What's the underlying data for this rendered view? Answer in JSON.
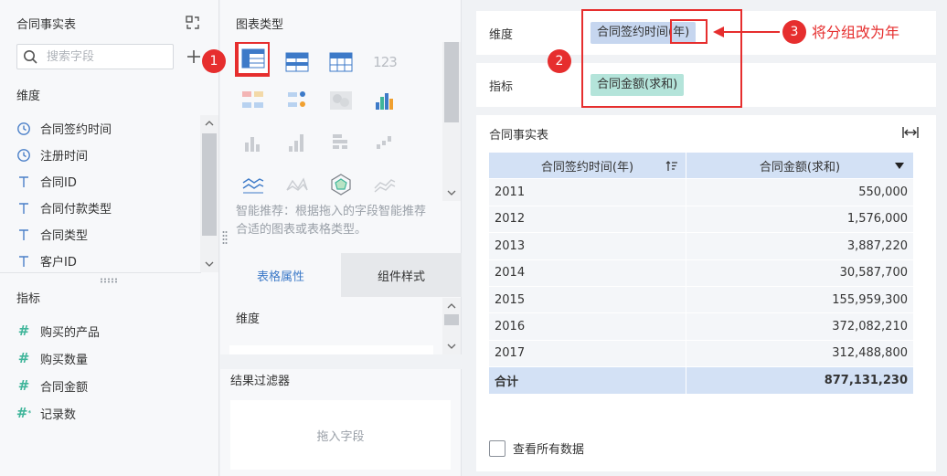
{
  "left_panel": {
    "title": "合同事实表",
    "search_placeholder": "搜索字段",
    "dimension_label": "维度",
    "dimension_fields": [
      {
        "label": "合同签约时间",
        "icon": "clock-icon"
      },
      {
        "label": "注册时间",
        "icon": "clock-icon"
      },
      {
        "label": "合同ID",
        "icon": "text-type-icon"
      },
      {
        "label": "合同付款类型",
        "icon": "text-type-icon"
      },
      {
        "label": "合同类型",
        "icon": "text-type-icon"
      },
      {
        "label": "客户ID",
        "icon": "text-type-icon"
      }
    ],
    "metric_label": "指标",
    "metric_fields": [
      {
        "label": "购买的产品",
        "icon": "number-type-icon"
      },
      {
        "label": "购买数量",
        "icon": "number-type-icon"
      },
      {
        "label": "合同金额",
        "icon": "number-type-icon"
      },
      {
        "label": "记录数",
        "icon": "number-type-icon"
      }
    ]
  },
  "middle_panel": {
    "title": "图表类型",
    "chart_number_icon_text": "123",
    "smart_tip": "智能推荐：根据拖入的字段智能推荐合适的图表或表格类型。",
    "tabs": [
      "表格属性",
      "组件样式"
    ],
    "dimension_label": "维度",
    "filter_title": "结果过滤器",
    "filter_placeholder": "拖入字段"
  },
  "right_panel": {
    "dimension_label": "维度",
    "dimension_pill_prefix": "合同签约时间",
    "dimension_pill_group": "(年)",
    "metric_label": "指标",
    "metric_pill": "合同金额(求和)",
    "table_title": "合同事实表",
    "columns": [
      "合同签约时间(年)",
      "合同金额(求和)"
    ],
    "rows": [
      [
        "2011",
        "550,000"
      ],
      [
        "2012",
        "1,576,000"
      ],
      [
        "2013",
        "3,887,220"
      ],
      [
        "2014",
        "30,587,700"
      ],
      [
        "2015",
        "155,959,300"
      ],
      [
        "2016",
        "372,082,210"
      ],
      [
        "2017",
        "312,488,800"
      ]
    ],
    "total_label": "合计",
    "total_value": "877,131,230",
    "view_all_label": "查看所有数据"
  },
  "annotations": {
    "badge_1": "1",
    "badge_2": "2",
    "badge_3": "3",
    "note_3": "将分组改为年",
    "color": "#e62e2e"
  },
  "colors": {
    "accent": "#3d7ac8",
    "dimension_pill": "#c6d6ef",
    "metric_pill": "#b4e4da",
    "table_header": "#d3e1f5"
  }
}
